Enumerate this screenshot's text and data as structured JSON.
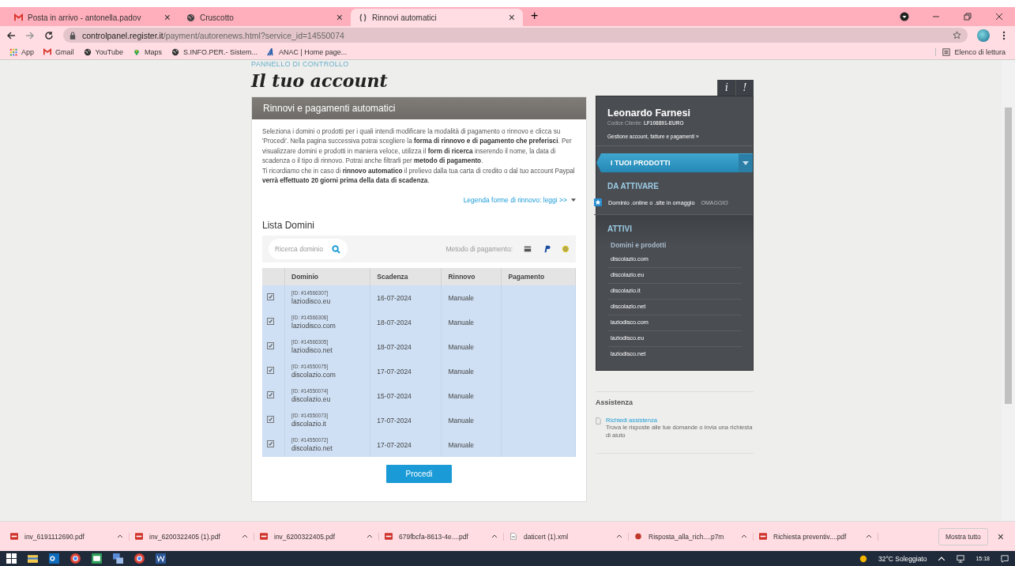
{
  "browser": {
    "tabs": [
      {
        "title": "Posta in arrivo - antonella.padov",
        "kind": "mail",
        "selected": false,
        "close": "×"
      },
      {
        "title": "Cruscotto",
        "kind": "globe",
        "selected": false,
        "close": "×"
      },
      {
        "title": "Rinnovi automatici",
        "kind": "loading",
        "selected": true,
        "close": "×"
      }
    ],
    "new_tab": "+",
    "url_host": "controlpanel.register.it",
    "url_path": "/payment/autorenews.html?service_id=14550074",
    "bookmarks": [
      {
        "label": "App",
        "kind": "apps"
      },
      {
        "label": "Gmail",
        "kind": "mail"
      },
      {
        "label": "YouTube",
        "kind": "globe"
      },
      {
        "label": "Maps",
        "kind": "pin"
      },
      {
        "label": "S.INFO.PER.- Sistem...",
        "kind": "globe"
      },
      {
        "label": "ANAC | Home page...",
        "kind": "anac"
      }
    ],
    "reading_list": "Elenco di lettura"
  },
  "page": {
    "breadcrumb": "PANNELLO DI CONTROLLO",
    "title": "Il tuo account",
    "panel_title": "Rinnovi e pagamenti automatici",
    "paragraphs": [
      "Seleziona i domini o prodotti per i quali intendi modificare la modalità di pagamento o rinnovo e clicca su 'Procedi'. Nella pagina successiva potrai scegliere la **forma di rinnovo e di pagamento che preferisci**. Per visualizzare domini e prodotti in maniera veloce, utilizza il **form di ricerca** inserendo il nome, la data di scadenza o il tipo di rinnovo. Potrai anche filtrarli per **metodo di pagamento**.",
      "Ti ricordiamo che in caso di **rinnovo automatico** il prelievo dalla tua carta di credito o dal tuo account Paypal **verrà effettuato 20 giorni prima della data di scadenza**."
    ],
    "legend_link": "Legenda forme di rinnovo: leggi >>",
    "list_title": "Lista Domini",
    "search": {
      "placeholder": "Ricerca dominio"
    },
    "payment_label": "Metodo di pagamento:",
    "table": {
      "columns": [
        "Dominio",
        "Scadenza",
        "Rinnovo",
        "Pagamento"
      ],
      "rows": [
        {
          "checked": true,
          "id": "[ID: #14566307]",
          "domain": "laziodisco.eu",
          "expiry": "16-07-2024",
          "renewal": "Manuale"
        },
        {
          "checked": true,
          "id": "[ID: #14566306]",
          "domain": "laziodisco.com",
          "expiry": "18-07-2024",
          "renewal": "Manuale"
        },
        {
          "checked": true,
          "id": "[ID: #14566305]",
          "domain": "laziodisco.net",
          "expiry": "18-07-2024",
          "renewal": "Manuale"
        },
        {
          "checked": true,
          "id": "[ID: #14550075]",
          "domain": "discolazio.com",
          "expiry": "17-07-2024",
          "renewal": "Manuale"
        },
        {
          "checked": true,
          "id": "[ID: #14550074]",
          "domain": "discolazio.eu",
          "expiry": "15-07-2024",
          "renewal": "Manuale"
        },
        {
          "checked": true,
          "id": "[ID: #14550073]",
          "domain": "discolazio.it",
          "expiry": "17-07-2024",
          "renewal": "Manuale"
        },
        {
          "checked": true,
          "id": "[ID: #14550072]",
          "domain": "discolazio.net",
          "expiry": "17-07-2024",
          "renewal": "Manuale"
        }
      ]
    },
    "proceed_button": "Procedi"
  },
  "sidebar": {
    "tab_info": "i",
    "tab_alert": "!",
    "name": "Leonardo Farnesi",
    "code_label": "Codice Cliente:",
    "code": "LF108891-EURO",
    "account_link": "Gestione account, fatture e pagamenti »",
    "products_header": "I TUOI PRODOTTI",
    "to_activate_title": "DA ATTIVARE",
    "to_activate": [
      {
        "label": "Dominio .online o .site in omaggio",
        "badge": "OMAGGIO"
      }
    ],
    "active_title": "ATTIVI",
    "active_subtitle": "Domini e prodotti",
    "active": [
      "discolazio.com",
      "discolazio.eu",
      "discolazio.it",
      "discolazio.net",
      "laziodisco.com",
      "laziodisco.eu",
      "laziodisco.net"
    ]
  },
  "support": {
    "title": "Assistenza",
    "link": "Richiedi assistenza",
    "text": "Trova le risposte alle tue domande o invia una richiesta di aiuto"
  },
  "downloads": {
    "items": [
      {
        "name": "inv_6191112690.pdf",
        "kind": "pdf"
      },
      {
        "name": "inv_6200322405 (1).pdf",
        "kind": "pdf"
      },
      {
        "name": "inv_6200322405.pdf",
        "kind": "pdf"
      },
      {
        "name": "679fbcfa-8613-4e....pdf",
        "kind": "pdf"
      },
      {
        "name": "daticert (1).xml",
        "kind": "xml"
      },
      {
        "name": "Risposta_alla_rich....p7m",
        "kind": "p7m"
      },
      {
        "name": "Richiesta preventiv....pdf",
        "kind": "pdf"
      }
    ],
    "show_all": "Mostra tutto",
    "close": "×"
  },
  "taskbar": {
    "weather": "32°C Soleggiato",
    "time": "15:18"
  }
}
